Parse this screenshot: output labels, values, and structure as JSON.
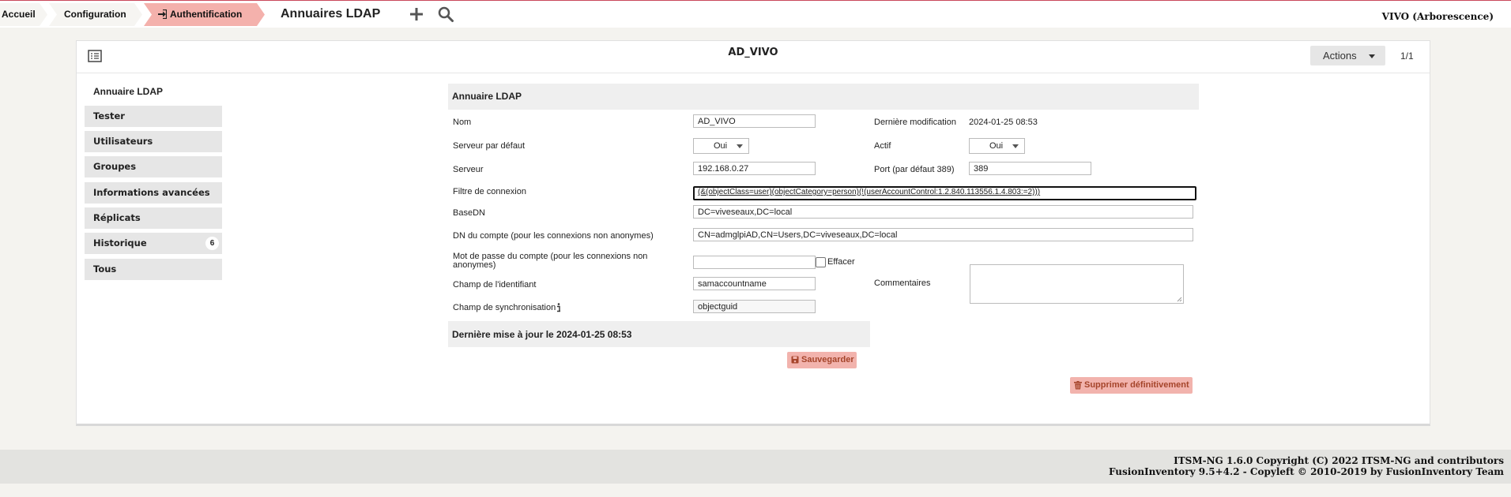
{
  "breadcrumb": {
    "home": "Accueil",
    "configuration": "Configuration",
    "authentication": "Authentification",
    "current": "Annuaires LDAP"
  },
  "header": {
    "entity": "VIVO (Arborescence)"
  },
  "card": {
    "title": "AD_VIVO",
    "actions_label": "Actions",
    "pager": "1/1"
  },
  "sidebar": {
    "title": "Annuaire LDAP",
    "items": [
      {
        "label": "Tester"
      },
      {
        "label": "Utilisateurs"
      },
      {
        "label": "Groupes"
      },
      {
        "label": "Informations avancées"
      },
      {
        "label": "Réplicats"
      },
      {
        "label": "Historique",
        "count": "6"
      },
      {
        "label": "Tous"
      }
    ]
  },
  "form": {
    "heading": "Annuaire LDAP",
    "name_label": "Nom",
    "name_value": "AD_VIVO",
    "last_modified_label": "Dernière modification",
    "last_modified_value": "2024-01-25 08:53",
    "default_server_label": "Serveur par défaut",
    "default_server_value": "Oui",
    "active_label": "Actif",
    "active_value": "Oui",
    "server_label": "Serveur",
    "server_value": "192.168.0.27",
    "port_label": "Port (par défaut 389)",
    "port_value": "389",
    "filter_label": "Filtre de connexion",
    "filter_value": "(&(objectClass=user)(objectCategory=person)(!(userAccountControl:1.2.840.113556.1.4.803:=2)))",
    "basedn_label": "BaseDN",
    "basedn_value": "DC=viveseaux,DC=local",
    "account_dn_label": "DN du compte (pour les connexions non anonymes)",
    "account_dn_value": "CN=admglpiAD,CN=Users,DC=viveseaux,DC=local",
    "password_label": "Mot de passe du compte (pour les connexions non anonymes)",
    "clear_label": "Effacer",
    "identifier_label": "Champ de l'identifiant",
    "identifier_value": "samaccountname",
    "comments_label": "Commentaires",
    "sync_label": "Champ de synchronisation",
    "sync_value": "objectguid",
    "last_update": "Dernière mise à jour le 2024-01-25 08:53",
    "save_label": "Sauvegarder",
    "delete_label": "Supprimer définitivement"
  },
  "footer": {
    "line1": "ITSM-NG 1.6.0 Copyright (C) 2022 ITSM-NG and contributors",
    "line2": "FusionInventory 9.5+4.2 - Copyleft © 2010-2019 by FusionInventory Team"
  },
  "colors": {
    "accent": "#c9485b",
    "active_crumb": "#f4b1ac",
    "danger_button": "#f2b3ad"
  }
}
